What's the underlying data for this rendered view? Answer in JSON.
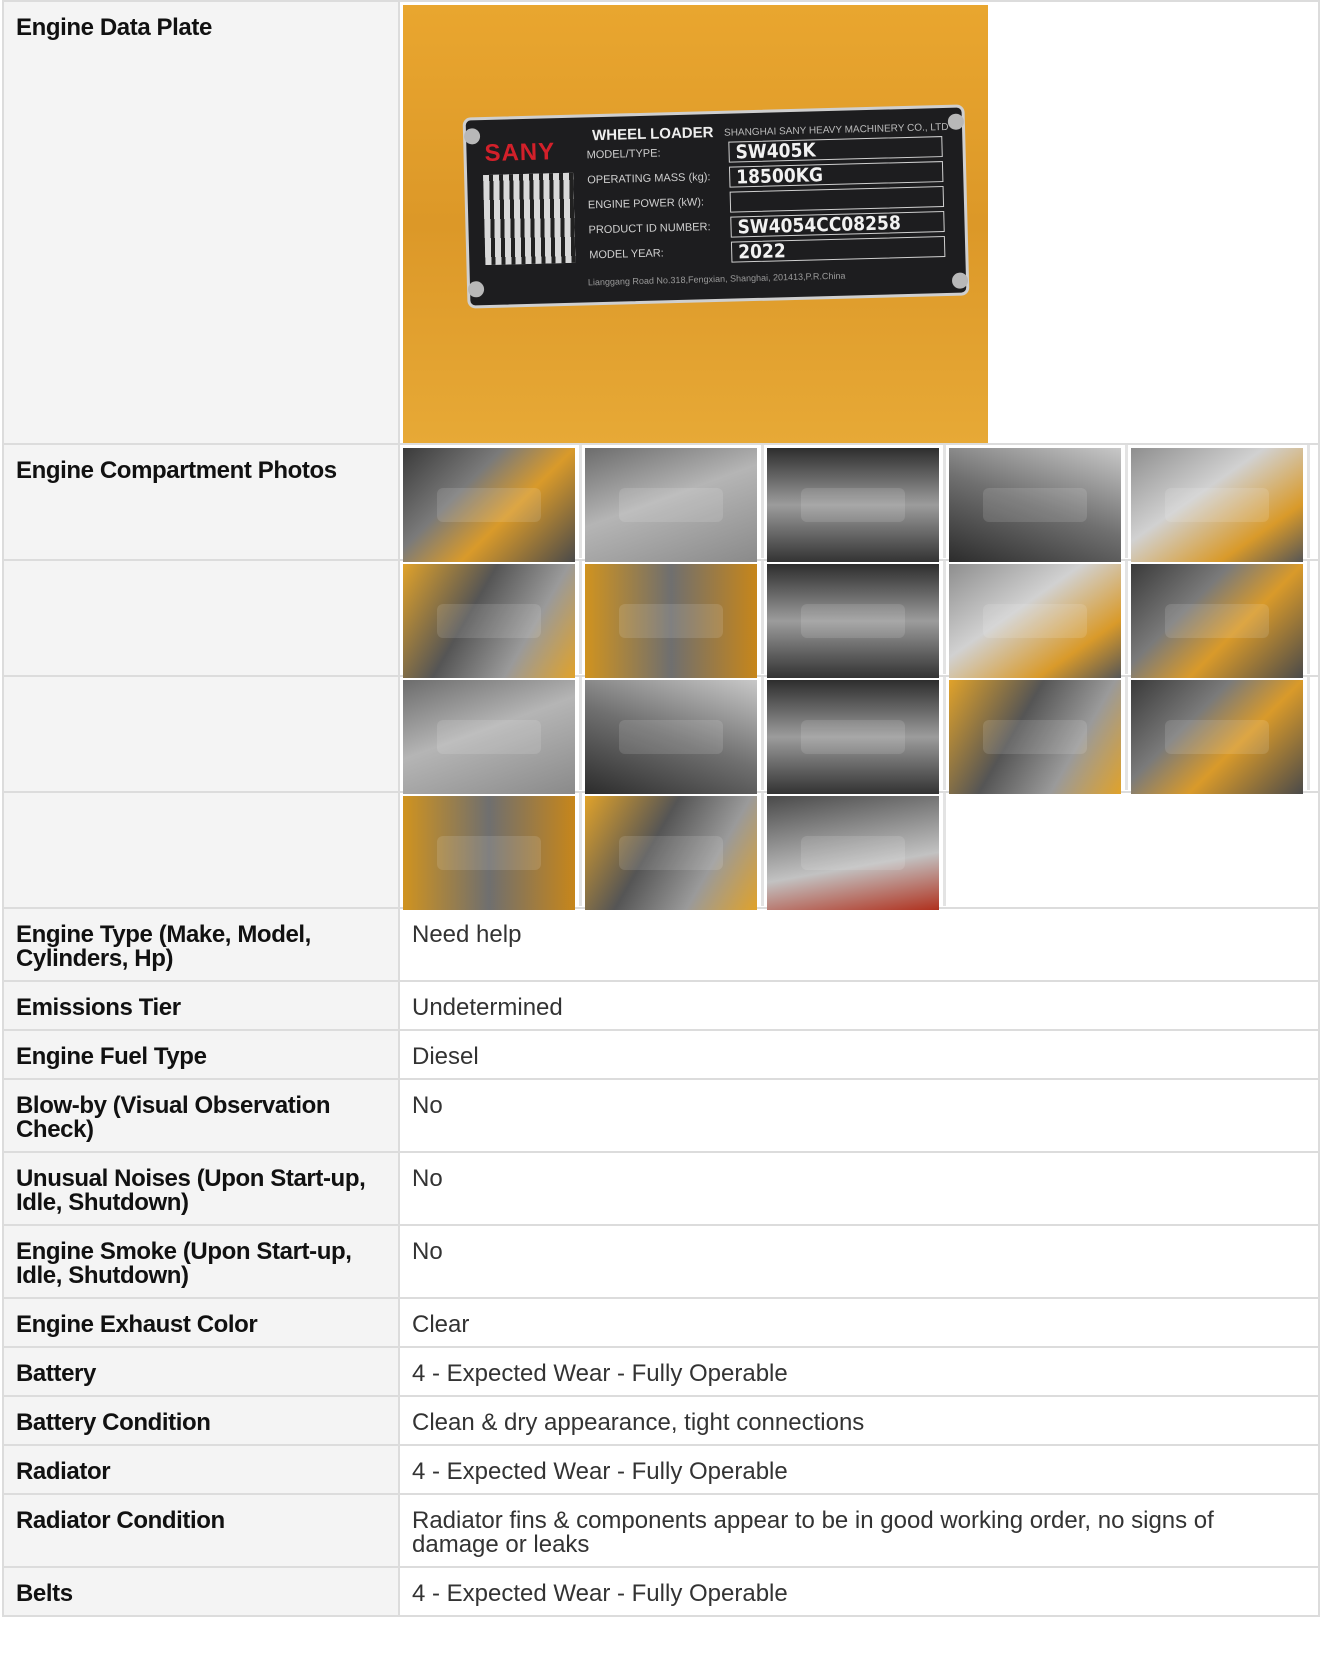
{
  "rows": {
    "engine_data_plate": {
      "label": "Engine Data Plate"
    },
    "engine_compartment_photos": {
      "label": "Engine Compartment Photos"
    },
    "engine_type": {
      "label": "Engine Type (Make, Model, Cylinders, Hp)",
      "value": "Need help"
    },
    "emissions_tier": {
      "label": "Emissions Tier",
      "value": "Undetermined"
    },
    "engine_fuel_type": {
      "label": "Engine Fuel Type",
      "value": "Diesel"
    },
    "blow_by": {
      "label": "Blow-by (Visual Observation Check)",
      "value": "No"
    },
    "unusual_noises": {
      "label": "Unusual Noises (Upon Start-up, Idle, Shutdown)",
      "value": "No"
    },
    "engine_smoke": {
      "label": "Engine Smoke (Upon Start-up, Idle, Shutdown)",
      "value": "No"
    },
    "exhaust_color": {
      "label": "Engine Exhaust Color",
      "value": "Clear"
    },
    "battery": {
      "label": "Battery",
      "value": "4 - Expected Wear - Fully Operable"
    },
    "battery_condition": {
      "label": "Battery Condition",
      "value": "Clean & dry appearance, tight connections"
    },
    "radiator": {
      "label": "Radiator",
      "value": "4 - Expected Wear - Fully Operable"
    },
    "radiator_condition": {
      "label": "Radiator Condition",
      "value": "Radiator fins & components appear to be in good working order, no signs of damage or leaks"
    },
    "belts": {
      "label": "Belts",
      "value": "4 - Expected Wear - Fully Operable"
    }
  },
  "data_plate": {
    "brand": "SANY",
    "heading": "WHEEL LOADER",
    "maker": "SHANGHAI SANY HEAVY MACHINERY CO., LTD",
    "fields": [
      {
        "label": "MODEL/TYPE:",
        "value": "SW405K"
      },
      {
        "label": "OPERATING MASS (kg):",
        "value": "18500KG"
      },
      {
        "label": "ENGINE POWER (kW):",
        "value": ""
      },
      {
        "label": "PRODUCT ID NUMBER:",
        "value": "SW4054CC08258"
      },
      {
        "label": "MODEL YEAR:",
        "value": "2022"
      }
    ],
    "address": "Lianggang Road No.318,Fengxian, Shanghai, 201413,P.R.China"
  },
  "photo_rows": [
    {
      "thumbs": [
        "engine-photo",
        "emissions-label-photo",
        "emissions-label-photo",
        "emissions-label-photo",
        "engine-photo"
      ]
    },
    {
      "thumbs": [
        "engine-photo",
        "frame-photo",
        "radiator-photo",
        "engine-photo",
        "engine-photo"
      ]
    },
    {
      "thumbs": [
        "engine-photo",
        "engine-photo",
        "radiator-photo",
        "engine-photo",
        "engine-photo"
      ]
    },
    {
      "thumbs": [
        "underside-photo",
        "frame-photo",
        "fuel-filter-photo"
      ]
    }
  ]
}
